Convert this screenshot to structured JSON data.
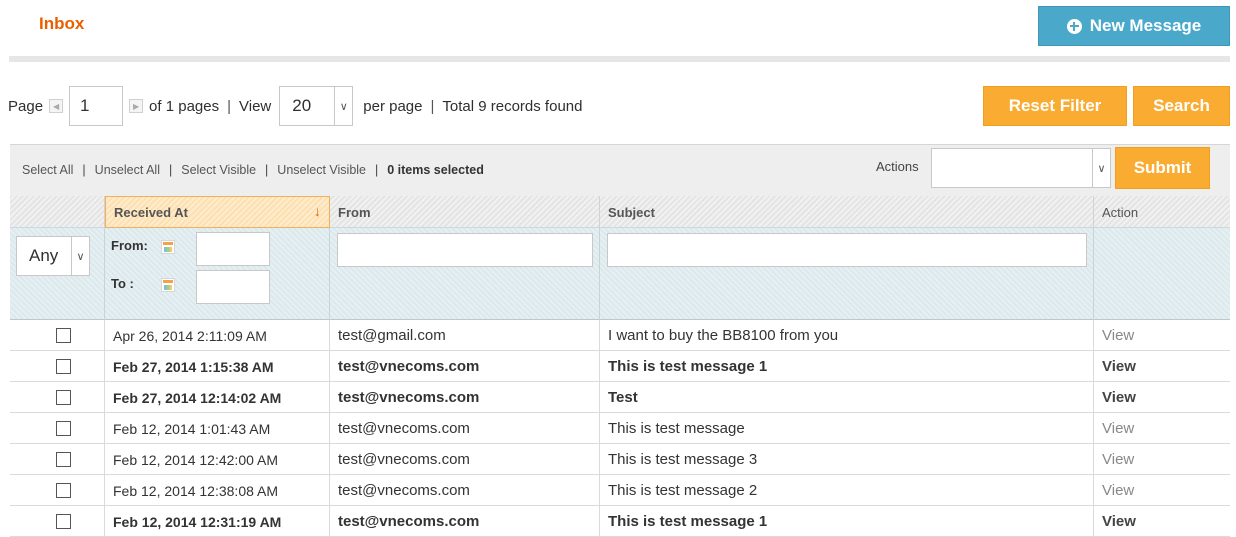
{
  "header": {
    "title": "Inbox",
    "new_message_label": "New Message"
  },
  "pager": {
    "page_label": "Page",
    "page_value": "1",
    "of_pages": "of 1 pages",
    "sep": "|",
    "view_label": "View",
    "view_value": "20",
    "per_page": "per page",
    "total": "Total 9 records found"
  },
  "buttons": {
    "reset_filter": "Reset Filter",
    "search": "Search",
    "submit": "Submit"
  },
  "massaction": {
    "select_all": "Select All",
    "unselect_all": "Unselect All",
    "select_visible": "Select Visible",
    "unselect_visible": "Unselect Visible",
    "items_selected": "0 items selected",
    "actions_label": "Actions",
    "actions_value": ""
  },
  "grid": {
    "columns": {
      "received_at": "Received At",
      "from": "From",
      "subject": "Subject",
      "action": "Action"
    },
    "filters": {
      "any": "Any",
      "from_label": "From:",
      "to_label": "To :"
    },
    "rows": [
      {
        "received": "Apr 26, 2014 2:11:09 AM",
        "from": "test@gmail.com",
        "subject": "I want to buy the BB8100 from you",
        "action": "View",
        "unread": false
      },
      {
        "received": "Feb 27, 2014 1:15:38 AM",
        "from": "test@vnecoms.com",
        "subject": "This is test message 1",
        "action": "View",
        "unread": true
      },
      {
        "received": "Feb 27, 2014 12:14:02 AM",
        "from": "test@vnecoms.com",
        "subject": "Test",
        "action": "View",
        "unread": true
      },
      {
        "received": "Feb 12, 2014 1:01:43 AM",
        "from": "test@vnecoms.com",
        "subject": "This is test message",
        "action": "View",
        "unread": false
      },
      {
        "received": "Feb 12, 2014 12:42:00 AM",
        "from": "test@vnecoms.com",
        "subject": "This is test message 3",
        "action": "View",
        "unread": false
      },
      {
        "received": "Feb 12, 2014 12:38:08 AM",
        "from": "test@vnecoms.com",
        "subject": "This is test message 2",
        "action": "View",
        "unread": false
      },
      {
        "received": "Feb 12, 2014 12:31:19 AM",
        "from": "test@vnecoms.com",
        "subject": "This is test message 1",
        "action": "View",
        "unread": true
      }
    ]
  },
  "colors": {
    "accent_orange": "#faab31",
    "title_orange": "#eb5e00",
    "new_message_blue": "#4aa9cb"
  }
}
